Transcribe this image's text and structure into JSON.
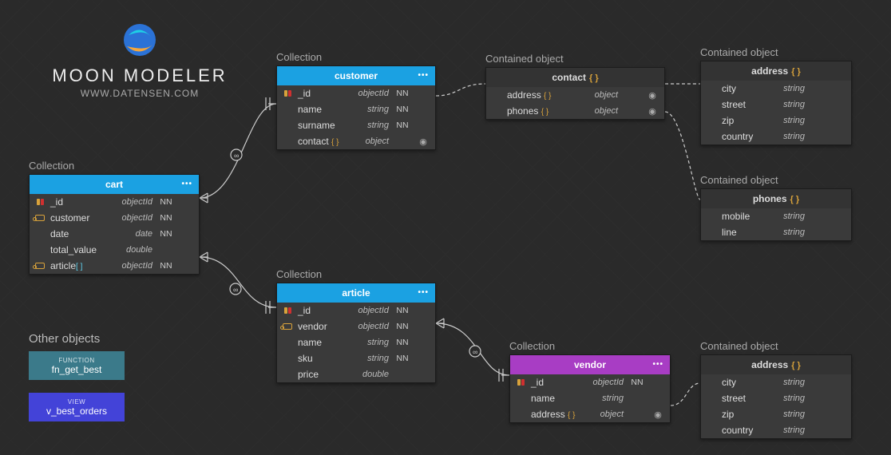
{
  "logo": {
    "title": "MOON MODELER",
    "url": "WWW.DATENSEN.COM"
  },
  "labels": {
    "cart": "Collection",
    "customer": "Collection",
    "article": "Collection",
    "vendor": "Collection",
    "contact": "Contained object",
    "address1": "Contained object",
    "phones": "Contained object",
    "address2": "Contained object",
    "other": "Other objects"
  },
  "headers": {
    "cart": "cart",
    "customer": "customer",
    "article": "article",
    "vendor": "vendor",
    "contact": "contact",
    "address1": "address",
    "phones": "phones",
    "address2": "address"
  },
  "fields": {
    "cart": [
      {
        "name": "_id",
        "type": "objectId",
        "nn": "NN",
        "icon": "key",
        "braces": "",
        "brk": "",
        "eye": ""
      },
      {
        "name": "customer",
        "type": "objectId",
        "nn": "NN",
        "icon": "link",
        "braces": "",
        "brk": "",
        "eye": ""
      },
      {
        "name": "date",
        "type": "date",
        "nn": "NN",
        "icon": "",
        "braces": "",
        "brk": "",
        "eye": ""
      },
      {
        "name": "total_value",
        "type": "double",
        "nn": "",
        "icon": "",
        "braces": "",
        "brk": "",
        "eye": ""
      },
      {
        "name": "article",
        "type": "objectId",
        "nn": "NN",
        "icon": "link",
        "braces": "",
        "brk": "[ ]",
        "eye": ""
      }
    ],
    "customer": [
      {
        "name": "_id",
        "type": "objectId",
        "nn": "NN",
        "icon": "key",
        "braces": "",
        "brk": "",
        "eye": ""
      },
      {
        "name": "name",
        "type": "string",
        "nn": "NN",
        "icon": "",
        "braces": "",
        "brk": "",
        "eye": ""
      },
      {
        "name": "surname",
        "type": "string",
        "nn": "NN",
        "icon": "",
        "braces": "",
        "brk": "",
        "eye": ""
      },
      {
        "name": "contact",
        "type": "object",
        "nn": "",
        "icon": "",
        "braces": "{ }",
        "brk": "",
        "eye": "◉"
      }
    ],
    "article": [
      {
        "name": "_id",
        "type": "objectId",
        "nn": "NN",
        "icon": "key",
        "braces": "",
        "brk": "",
        "eye": ""
      },
      {
        "name": "vendor",
        "type": "objectId",
        "nn": "NN",
        "icon": "link",
        "braces": "",
        "brk": "",
        "eye": ""
      },
      {
        "name": "name",
        "type": "string",
        "nn": "NN",
        "icon": "",
        "braces": "",
        "brk": "",
        "eye": ""
      },
      {
        "name": "sku",
        "type": "string",
        "nn": "NN",
        "icon": "",
        "braces": "",
        "brk": "",
        "eye": ""
      },
      {
        "name": "price",
        "type": "double",
        "nn": "",
        "icon": "",
        "braces": "",
        "brk": "",
        "eye": ""
      }
    ],
    "vendor": [
      {
        "name": "_id",
        "type": "objectId",
        "nn": "NN",
        "icon": "key",
        "braces": "",
        "brk": "",
        "eye": ""
      },
      {
        "name": "name",
        "type": "string",
        "nn": "",
        "icon": "",
        "braces": "",
        "brk": "",
        "eye": ""
      },
      {
        "name": "address",
        "type": "object",
        "nn": "",
        "icon": "",
        "braces": "{ }",
        "brk": "",
        "eye": "◉"
      }
    ],
    "contact": [
      {
        "name": "address",
        "type": "object",
        "nn": "",
        "icon": "",
        "braces": "{ }",
        "brk": "",
        "eye": "◉"
      },
      {
        "name": "phones",
        "type": "object",
        "nn": "",
        "icon": "",
        "braces": "{ }",
        "brk": "",
        "eye": "◉"
      }
    ],
    "address1": [
      {
        "name": "city",
        "type": "string",
        "nn": "",
        "icon": "",
        "braces": "",
        "brk": "",
        "eye": ""
      },
      {
        "name": "street",
        "type": "string",
        "nn": "",
        "icon": "",
        "braces": "",
        "brk": "",
        "eye": ""
      },
      {
        "name": "zip",
        "type": "string",
        "nn": "",
        "icon": "",
        "braces": "",
        "brk": "",
        "eye": ""
      },
      {
        "name": "country",
        "type": "string",
        "nn": "",
        "icon": "",
        "braces": "",
        "brk": "",
        "eye": ""
      }
    ],
    "phones": [
      {
        "name": "mobile",
        "type": "string",
        "nn": "",
        "icon": "",
        "braces": "",
        "brk": "",
        "eye": ""
      },
      {
        "name": "line",
        "type": "string",
        "nn": "",
        "icon": "",
        "braces": "",
        "brk": "",
        "eye": ""
      }
    ],
    "address2": [
      {
        "name": "city",
        "type": "string",
        "nn": "",
        "icon": "",
        "braces": "",
        "brk": "",
        "eye": ""
      },
      {
        "name": "street",
        "type": "string",
        "nn": "",
        "icon": "",
        "braces": "",
        "brk": "",
        "eye": ""
      },
      {
        "name": "zip",
        "type": "string",
        "nn": "",
        "icon": "",
        "braces": "",
        "brk": "",
        "eye": ""
      },
      {
        "name": "country",
        "type": "string",
        "nn": "",
        "icon": "",
        "braces": "",
        "brk": "",
        "eye": ""
      }
    ]
  },
  "other": {
    "func_label": "FUNCTION",
    "func_name": "fn_get_best",
    "view_label": "VIEW",
    "view_name": "v_best_orders"
  }
}
